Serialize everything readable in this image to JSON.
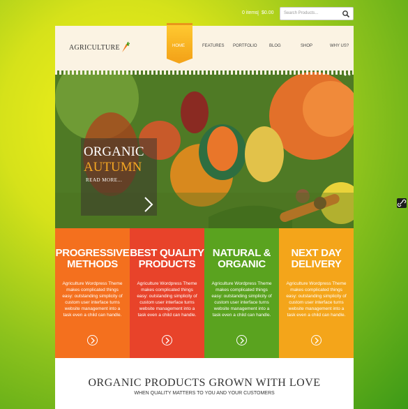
{
  "topbar": {
    "cart_items": "0 items",
    "cart_separator": "|",
    "cart_total": "$0.00",
    "search_placeholder": "Search Products..."
  },
  "header": {
    "logo": "AGRICULTURE",
    "logo_icon": "carrot-icon",
    "nav": [
      "HOME",
      "FEATURES",
      "PORTFOLIO",
      "BLOG",
      "SHOP",
      "WHY US?"
    ],
    "active_nav": "HOME"
  },
  "hero": {
    "title_line1": "ORGANIC",
    "title_line2": "AUTUMN",
    "read_more": "READ MORE...",
    "arrow_icon": "chevron-right-icon"
  },
  "features": [
    {
      "title": "PROGRESSIVE METHODS",
      "text": "Agriculture Wordpress Theme makes complicated things easy: outstanding simplicity of custom user interface turns website management into a task even a child can handle.",
      "color": "#f4701e"
    },
    {
      "title": "BEST QUALITY PRODUCTS",
      "text": "Agriculture Wordpress Theme makes complicated things easy: outstanding simplicity of custom user interface turns website management into a task even a child can handle.",
      "color": "#e8432a"
    },
    {
      "title": "NATURAL & ORGANIC",
      "text": "Agriculture Wordpress Theme makes complicated things easy: outstanding simplicity of custom user interface turns website management into a task even a child can handle.",
      "color": "#5aa31f"
    },
    {
      "title": "NEXT DAY DELIVERY",
      "text": "Agriculture Wordpress Theme makes complicated things easy: outstanding simplicity of custom user interface turns website management into a task even a child can handle.",
      "color": "#f4a51a"
    }
  ],
  "bottom": {
    "title": "ORGANIC PRODUCTS GROWN WITH LOVE",
    "subtitle": "WHEN QUALITY MATTERS TO YOU AND YOUR CUSTOMERS"
  },
  "colors": {
    "accent": "#f4a51a",
    "orange": "#f4701e",
    "red": "#e8432a",
    "green": "#5aa31f"
  }
}
